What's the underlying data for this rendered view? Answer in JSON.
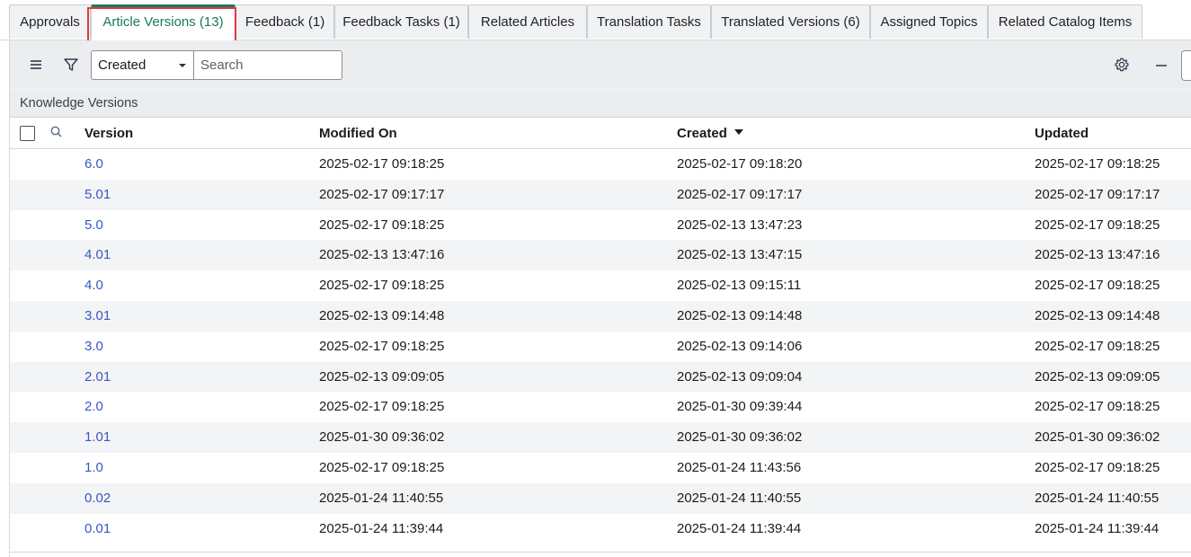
{
  "tabs": [
    {
      "label": "Approvals",
      "active": false
    },
    {
      "label": "Article Versions (13)",
      "active": true
    },
    {
      "label": "Feedback (1)",
      "active": false
    },
    {
      "label": "Feedback Tasks (1)",
      "active": false
    },
    {
      "label": "Related Articles",
      "active": false
    },
    {
      "label": "Translation Tasks",
      "active": false
    },
    {
      "label": "Translated Versions (6)",
      "active": false
    },
    {
      "label": "Assigned Topics",
      "active": false
    },
    {
      "label": "Related Catalog Items",
      "active": false
    }
  ],
  "toolbar": {
    "menu_icon": "hamburger-menu-icon",
    "filter_icon": "filter-icon",
    "field_select_value": "Created",
    "search_placeholder": "Search",
    "settings_icon": "gear-icon",
    "collapse_icon": "minimize-icon"
  },
  "list_title": "Knowledge Versions",
  "table": {
    "columns": [
      "Version",
      "Modified On",
      "Created",
      "Updated"
    ],
    "sorted_column": "Created",
    "sort_direction": "descending",
    "rows": [
      {
        "version": "6.0",
        "modified_on": "2025-02-17 09:18:25",
        "created": "2025-02-17 09:18:20",
        "updated": "2025-02-17 09:18:25"
      },
      {
        "version": "5.01",
        "modified_on": "2025-02-17 09:17:17",
        "created": "2025-02-17 09:17:17",
        "updated": "2025-02-17 09:17:17"
      },
      {
        "version": "5.0",
        "modified_on": "2025-02-17 09:18:25",
        "created": "2025-02-13 13:47:23",
        "updated": "2025-02-17 09:18:25"
      },
      {
        "version": "4.01",
        "modified_on": "2025-02-13 13:47:16",
        "created": "2025-02-13 13:47:15",
        "updated": "2025-02-13 13:47:16"
      },
      {
        "version": "4.0",
        "modified_on": "2025-02-17 09:18:25",
        "created": "2025-02-13 09:15:11",
        "updated": "2025-02-17 09:18:25"
      },
      {
        "version": "3.01",
        "modified_on": "2025-02-13 09:14:48",
        "created": "2025-02-13 09:14:48",
        "updated": "2025-02-13 09:14:48"
      },
      {
        "version": "3.0",
        "modified_on": "2025-02-17 09:18:25",
        "created": "2025-02-13 09:14:06",
        "updated": "2025-02-17 09:18:25"
      },
      {
        "version": "2.01",
        "modified_on": "2025-02-13 09:09:05",
        "created": "2025-02-13 09:09:04",
        "updated": "2025-02-13 09:09:05"
      },
      {
        "version": "2.0",
        "modified_on": "2025-02-17 09:18:25",
        "created": "2025-01-30 09:39:44",
        "updated": "2025-02-17 09:18:25"
      },
      {
        "version": "1.01",
        "modified_on": "2025-01-30 09:36:02",
        "created": "2025-01-30 09:36:02",
        "updated": "2025-01-30 09:36:02"
      },
      {
        "version": "1.0",
        "modified_on": "2025-02-17 09:18:25",
        "created": "2025-01-24 11:43:56",
        "updated": "2025-02-17 09:18:25"
      },
      {
        "version": "0.02",
        "modified_on": "2025-01-24 11:40:55",
        "created": "2025-01-24 11:40:55",
        "updated": "2025-01-24 11:40:55"
      },
      {
        "version": "0.01",
        "modified_on": "2025-01-24 11:39:44",
        "created": "2025-01-24 11:39:44",
        "updated": "2025-01-24 11:39:44"
      }
    ]
  },
  "colors": {
    "active_tab_accent": "#167a5f",
    "link": "#3a56c6",
    "highlight_box": "#e0393e"
  }
}
